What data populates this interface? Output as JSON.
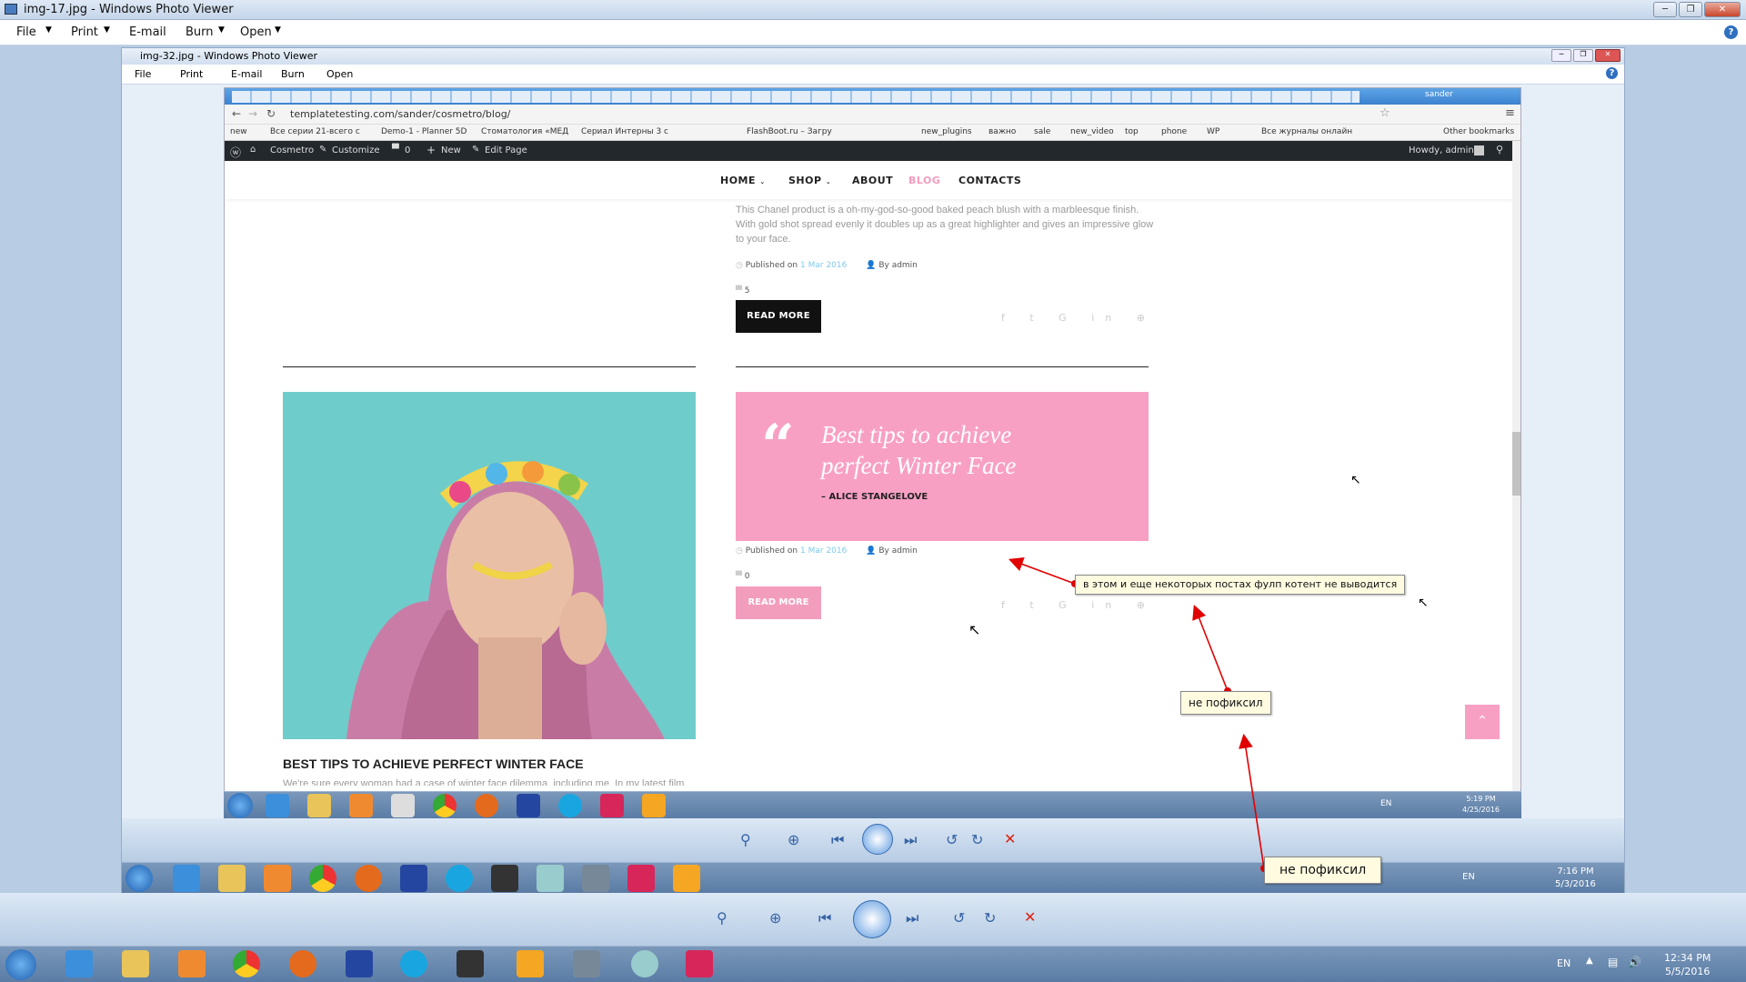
{
  "outer_window": {
    "title": "img-17.jpg - Windows Photo Viewer",
    "menu": [
      "File",
      "Print",
      "E-mail",
      "Burn",
      "Open"
    ]
  },
  "inner_window": {
    "title": "img-32.jpg - Windows Photo Viewer",
    "menu": [
      "File",
      "Print",
      "E-mail",
      "Burn",
      "Open"
    ]
  },
  "browser": {
    "url": "templatetesting.com/sander/cosmetro/blog/",
    "profile": "sander",
    "bookmarks": [
      "new",
      "Все серии 21-всего с",
      "Demo-1 - Planner 5D",
      "Стоматология «МЕД",
      "Сериал Интерны 3 с",
      "FlashBoot.ru – Загру",
      "new_plugins",
      "важно",
      "sale",
      "new_video",
      "top",
      "phone",
      "WP",
      "Все журналы онлайн",
      "Other bookmarks"
    ]
  },
  "wp_admin": {
    "site": "Cosmetro",
    "customize": "Customize",
    "comments": "0",
    "new": "New",
    "edit": "Edit Page",
    "greeting": "Howdy, admin"
  },
  "nav": {
    "home": "HOME",
    "shop": "SHOP",
    "about": "ABOUT",
    "blog": "BLOG",
    "contacts": "CONTACTS"
  },
  "post1": {
    "excerpt": "This Chanel product is a oh-my-god-so-good baked peach blush with a marbleesque finish. With gold shot spread evenly it doubles up as a great highlighter and gives an impressive glow to your face.",
    "published_label": "Published on",
    "date": "1 Mar 2016",
    "author_label": "By admin",
    "comments": "5",
    "read_more": "READ MORE"
  },
  "post2": {
    "title": "BEST TIPS TO ACHIEVE PERFECT WINTER FACE",
    "excerpt": "We're sure every woman had a case of winter face dilemma, including me. In my latest film",
    "quote_line1": "Best tips to achieve",
    "quote_line2": "perfect Winter Face",
    "quote_author": "– ALICE STANGELOVE",
    "published_label": "Published on",
    "date": "1 Mar 2016",
    "author_label": "By admin",
    "comments": "0",
    "read_more": "READ MORE"
  },
  "annotations": {
    "note1": "в этом и еще некоторых постах фулп котент не выводится",
    "note2": "не пофиксил",
    "note3": "не пофиксил"
  },
  "taskbars": {
    "lang": "EN",
    "inner_clock_time": "5:19 PM",
    "inner_clock_date": "4/25/2016",
    "mid_clock_time": "7:16 PM",
    "mid_clock_date": "5/3/2016",
    "main_clock_time": "12:34 PM",
    "main_clock_date": "5/5/2016"
  },
  "colors": {
    "accent_pink": "#f39dbd",
    "link_blue": "#7fc9ea",
    "wp_bar": "#23282d",
    "arrow_red": "#e00000"
  }
}
